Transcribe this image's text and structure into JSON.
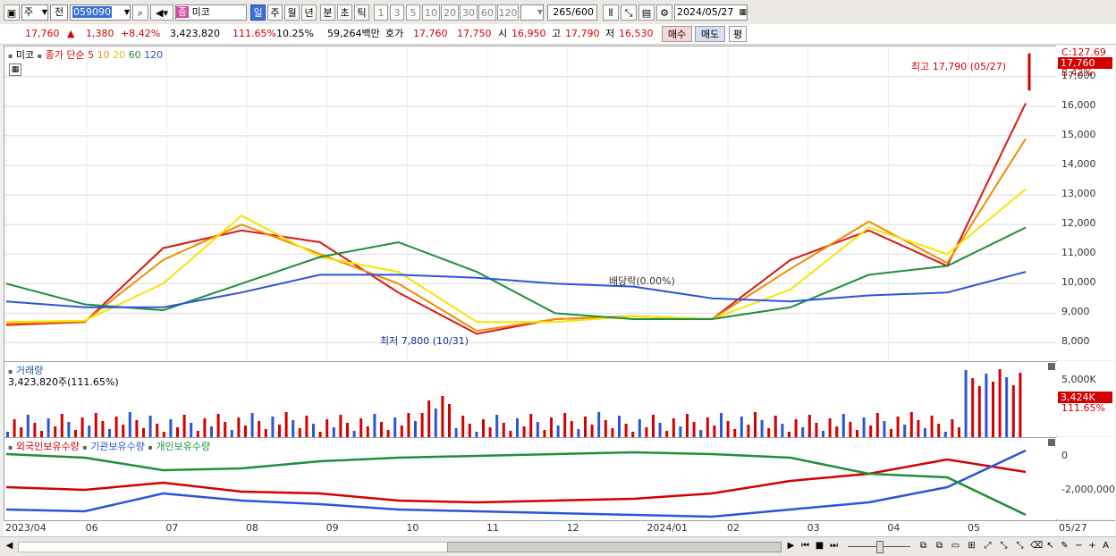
{
  "toolbar": {
    "market": "주",
    "prev": "전",
    "code": "059090",
    "stock_tag": "종",
    "stock_name": "미코",
    "period_tabs": [
      "일",
      "주",
      "월",
      "년",
      "분",
      "초",
      "틱"
    ],
    "active_period": "일",
    "intervals": [
      "1",
      "3",
      "5",
      "10",
      "20",
      "30",
      "60",
      "120"
    ],
    "count": "265",
    "count_total": "/600",
    "date": "2024/05/27"
  },
  "quote": {
    "price": "17,760",
    "up_arrow": "▲",
    "change": "1,380",
    "change_pct": "+8.42%",
    "volume": "3,423,820",
    "vol_ratio": "111.65%",
    "turnover": "10.25%",
    "amount": "59,264백만",
    "hoga_label": "호가",
    "ask": "17,760",
    "bid": "17,750",
    "open_label": "시",
    "open": "16,950",
    "high_label": "고",
    "high": "17,790",
    "low_label": "저",
    "low": "16,530",
    "buy": "매수",
    "sell": "매도",
    "pyeong": "평"
  },
  "price_panel": {
    "stock": "미코",
    "ma_label": "종가 단순",
    "ma_periods": [
      "5",
      "10",
      "20",
      "60",
      "120"
    ],
    "ma_colors": [
      "#d81818",
      "#f08c00",
      "#f5e600",
      "#1f8f3a",
      "#2b55d8"
    ],
    "c_value": "C:127.69",
    "price_tag": "17,760",
    "pct_tag": "8.42%",
    "y_ticks": [
      "17,000",
      "16,000",
      "15,000",
      "14,000",
      "13,000",
      "12,000",
      "11,000",
      "10,000",
      "9,000",
      "8,000"
    ],
    "high_note": "최고 17,790 (05/27)",
    "low_note": "최저 7,800 (10/31)",
    "dividend_note": "배당락(0.00%)"
  },
  "volume_panel": {
    "title": "거래량",
    "value": "3,423,820주(111.65%)",
    "y_tick": "5,000K",
    "tag": "3,424K",
    "tag_pct": "111.65%"
  },
  "holdings_panel": {
    "legend": [
      "외국인보유수량",
      "기관보유수량",
      "개인보유수량"
    ],
    "legend_colors": [
      "#d40000",
      "#2b55d8",
      "#1f8f3a"
    ],
    "y_ticks": [
      "0",
      "-2,000,000"
    ]
  },
  "x_axis": {
    "labels": [
      "2023/04",
      "06",
      "07",
      "08",
      "09",
      "10",
      "11",
      "12",
      "2024/01",
      "02",
      "03",
      "04",
      "05"
    ],
    "last": "05/27"
  },
  "chart_data": {
    "type": "line",
    "title": "미코",
    "x": [
      "2023/04",
      "06",
      "07",
      "08",
      "09",
      "10",
      "11",
      "12",
      "2024/01",
      "02",
      "03",
      "04",
      "05",
      "05/27"
    ],
    "series": [
      {
        "name": "5",
        "values": [
          8600,
          8700,
          11200,
          11800,
          11400,
          9700,
          8300,
          8800,
          8900,
          8800,
          10800,
          11800,
          10600,
          16100
        ]
      },
      {
        "name": "10",
        "values": [
          8650,
          8720,
          10800,
          12000,
          11000,
          10000,
          8400,
          8800,
          8900,
          8800,
          10500,
          12100,
          10700,
          14900
        ]
      },
      {
        "name": "20",
        "values": [
          8700,
          8750,
          10000,
          12300,
          10900,
          10400,
          8700,
          8700,
          8900,
          8800,
          9800,
          11900,
          11000,
          13200
        ]
      },
      {
        "name": "60",
        "values": [
          10000,
          9300,
          9100,
          10000,
          10900,
          11400,
          10400,
          9000,
          8800,
          8800,
          9200,
          10300,
          10600,
          11900
        ]
      },
      {
        "name": "120",
        "values": [
          9400,
          9200,
          9200,
          9700,
          10300,
          10300,
          10200,
          10000,
          9900,
          9500,
          9400,
          9600,
          9700,
          10400
        ]
      }
    ],
    "ylim": [
      7500,
      17900
    ]
  }
}
